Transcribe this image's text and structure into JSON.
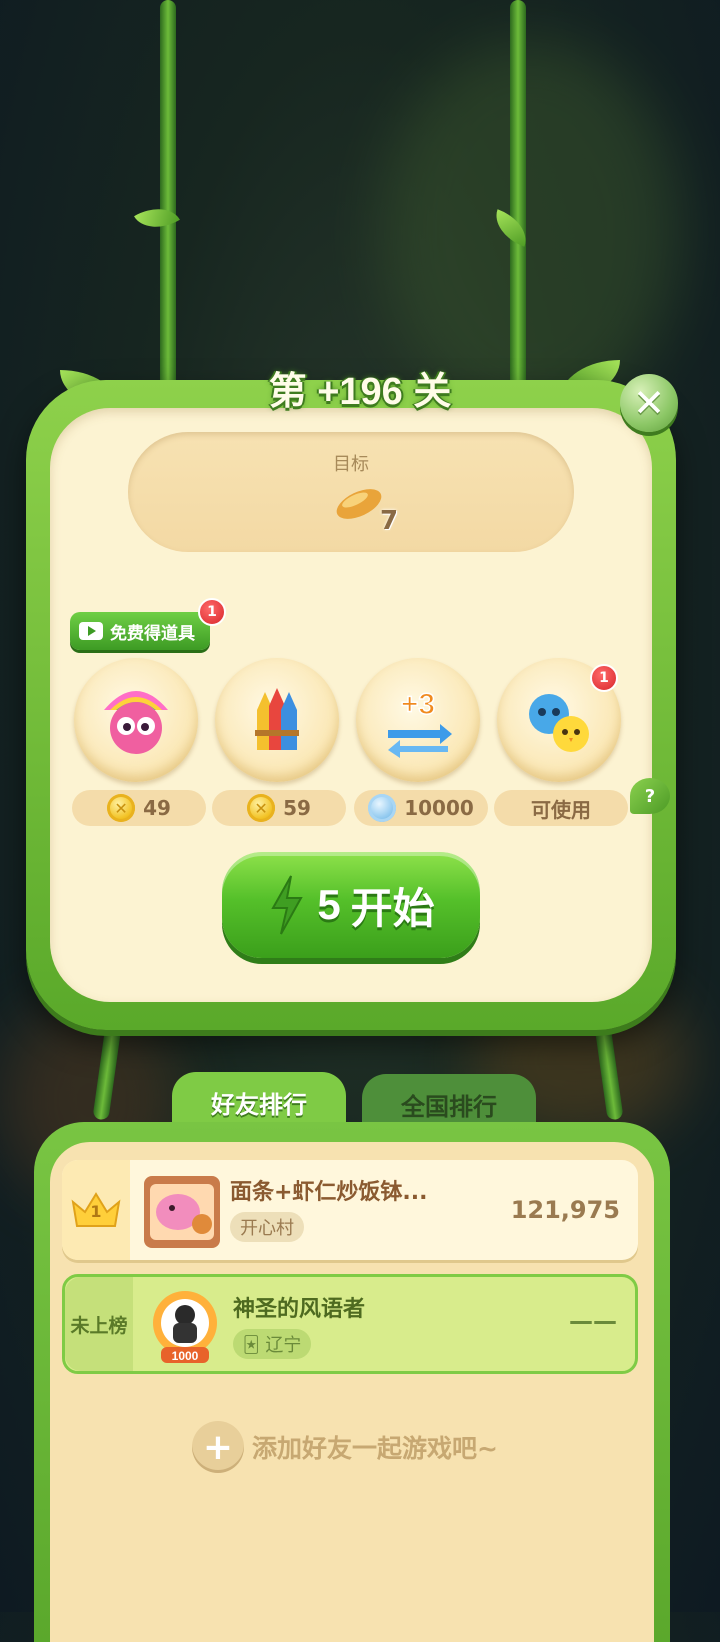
{
  "level": {
    "title": "第 +196 关"
  },
  "goal": {
    "label": "目标",
    "item_icon": "golden-bean-icon",
    "count": "7"
  },
  "free_props": {
    "label": "免费得道具",
    "badge": "1"
  },
  "boosters": [
    {
      "icon": "rainbow-owl-icon",
      "currency": "coin",
      "price": "49"
    },
    {
      "icon": "rocket-icon",
      "currency": "coin",
      "price": "59"
    },
    {
      "icon": "plus-three-moves-icon",
      "currency": "gem",
      "price": "10000"
    },
    {
      "icon": "animal-buddies-icon",
      "currency": "none",
      "price": "可使用",
      "badge": "1"
    }
  ],
  "help": {
    "label": "?"
  },
  "start": {
    "energy": "5",
    "label": "开始"
  },
  "tabs": [
    {
      "label": "好友排行",
      "active": true
    },
    {
      "label": "全国排行",
      "active": false
    }
  ],
  "leaderboard": {
    "rows": [
      {
        "rank": "1",
        "name": "面条+虾仁炒饭钵...",
        "location": "开心村",
        "score": "121,975"
      },
      {
        "rank_label": "未上榜",
        "name": "神圣的风语者",
        "location": "辽宁",
        "score": "——",
        "avatar_badge": "1000"
      }
    ],
    "add_friends": "添加好友一起游戏吧~"
  },
  "colors": {
    "accent_green": "#5aa92a",
    "panel_cream": "#fcf3d2",
    "badge_red": "#d8262a"
  }
}
